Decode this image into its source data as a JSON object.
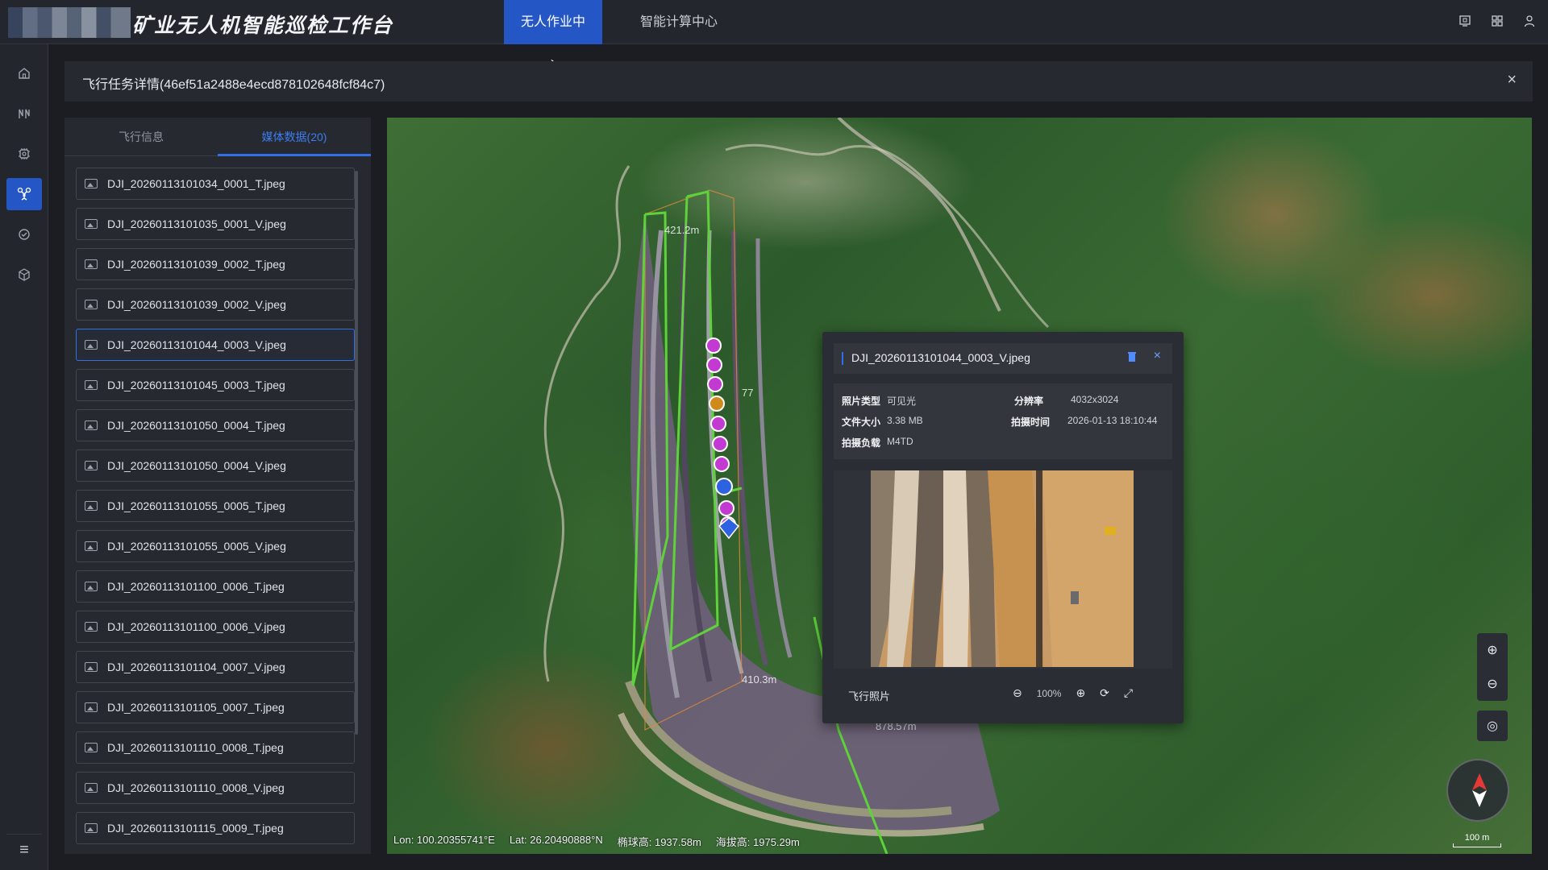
{
  "app": {
    "title": "矿业无人机智能巡检工作台",
    "tabs": [
      {
        "label": "无人作业中心",
        "active": true
      },
      {
        "label": "智能计算中心",
        "active": false
      }
    ]
  },
  "task": {
    "title": "飞行任务详情(46ef51a2488e4ecd878102648fcf84c7)",
    "close_icon": "×"
  },
  "panel": {
    "tabs": [
      {
        "label": "飞行信息",
        "active": false
      },
      {
        "label": "媒体数据(20)",
        "active": true
      }
    ],
    "files": [
      "DJI_20260113101034_0001_T.jpeg",
      "DJI_20260113101035_0001_V.jpeg",
      "DJI_20260113101039_0002_T.jpeg",
      "DJI_20260113101039_0002_V.jpeg",
      "DJI_20260113101044_0003_V.jpeg",
      "DJI_20260113101045_0003_T.jpeg",
      "DJI_20260113101050_0004_T.jpeg",
      "DJI_20260113101050_0004_V.jpeg",
      "DJI_20260113101055_0005_T.jpeg",
      "DJI_20260113101055_0005_V.jpeg",
      "DJI_20260113101100_0006_T.jpeg",
      "DJI_20260113101100_0006_V.jpeg",
      "DJI_20260113101104_0007_V.jpeg",
      "DJI_20260113101105_0007_T.jpeg",
      "DJI_20260113101110_0008_T.jpeg",
      "DJI_20260113101110_0008_V.jpeg",
      "DJI_20260113101115_0009_T.jpeg"
    ],
    "selected_index": 4
  },
  "map": {
    "distance_labels": [
      "421.2m",
      "410.3m",
      "878.57m"
    ],
    "distance_label_partial": "77",
    "coords": {
      "lon": "Lon: 100.20355741°E",
      "lat": "Lat: 26.20490888°N",
      "ellipsoid_height": "椭球高: 1937.58m",
      "altitude": "海拔高: 1975.29m"
    },
    "scale_label": "100 m",
    "zoom_in_icon": "⊕",
    "zoom_out_icon": "⊖",
    "locate_icon": "◎"
  },
  "popup": {
    "title": "DJI_20260113101044_0003_V.jpeg",
    "meta": {
      "photo_type_label": "照片类型",
      "photo_type": "可见光",
      "resolution_label": "分辨率",
      "resolution": "4032x3024",
      "file_size_label": "文件大小",
      "file_size": "3.38 MB",
      "capture_time_label": "拍摄时间",
      "capture_time": "2026-01-13 18:10:44",
      "payload_label": "拍摄负载",
      "payload": "M4TD"
    },
    "footer_label": "飞行照片",
    "zoom_level": "100%",
    "close_icon": "×"
  },
  "colors": {
    "accent": "#2457c5",
    "route_green": "#5fd13a",
    "waypoint_magenta": "#c23ad1",
    "waypoint_orange": "#d08a1c",
    "waypoint_blue": "#2d62e0"
  },
  "icons": [
    "monitor-icon",
    "grid-icon",
    "user-icon",
    "home-icon",
    "route-icon",
    "chip-icon",
    "drone-icon",
    "refresh-target-icon",
    "cube-icon",
    "menu-icon"
  ]
}
